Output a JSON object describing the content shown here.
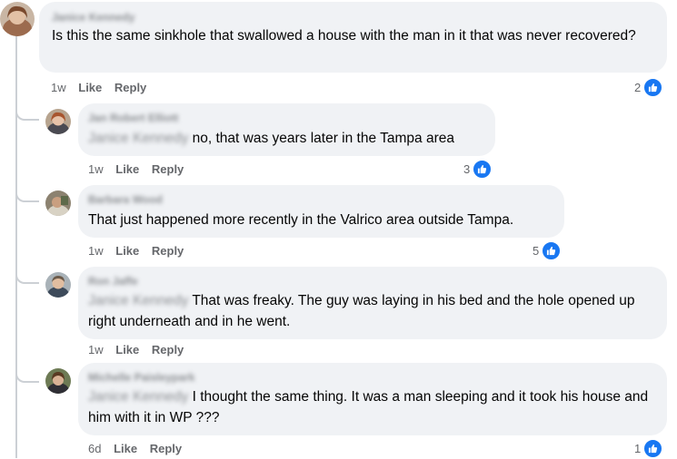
{
  "comments": [
    {
      "author": "Janice Kennedy",
      "text": "Is this the same sinkhole that swallowed a house with the man in it that was never recovered?",
      "time": "1w",
      "like_label": "Like",
      "reply_label": "Reply",
      "reactions": "2"
    },
    {
      "author": "Jan Robert Elliott",
      "mention": "Janice Kennedy",
      "text": "no, that was years later in the Tampa area",
      "time": "1w",
      "like_label": "Like",
      "reply_label": "Reply",
      "reactions": "3"
    },
    {
      "author": "Barbara Wood",
      "text": "That just happened more recently in the Valrico area outside Tampa.",
      "time": "1w",
      "like_label": "Like",
      "reply_label": "Reply",
      "reactions": "5"
    },
    {
      "author": "Ron Jaffe",
      "mention": "Janice Kennedy",
      "text": "That was freaky. The guy was laying in his bed and the hole opened up right underneath and in he went.",
      "time": "1w",
      "like_label": "Like",
      "reply_label": "Reply"
    },
    {
      "author": "Michelle Paisleypark",
      "mention": "Janice Kennedy",
      "text": "I thought the same thing. It was a man sleeping and it took his house and him with it in WP ???",
      "time": "6d",
      "like_label": "Like",
      "reply_label": "Reply",
      "reactions": "1"
    }
  ],
  "colors": {
    "bubble": "#f0f2f5",
    "like_blue": "#1877f2",
    "meta_text": "#65676b"
  },
  "icons": [
    "like-thumb-icon"
  ]
}
